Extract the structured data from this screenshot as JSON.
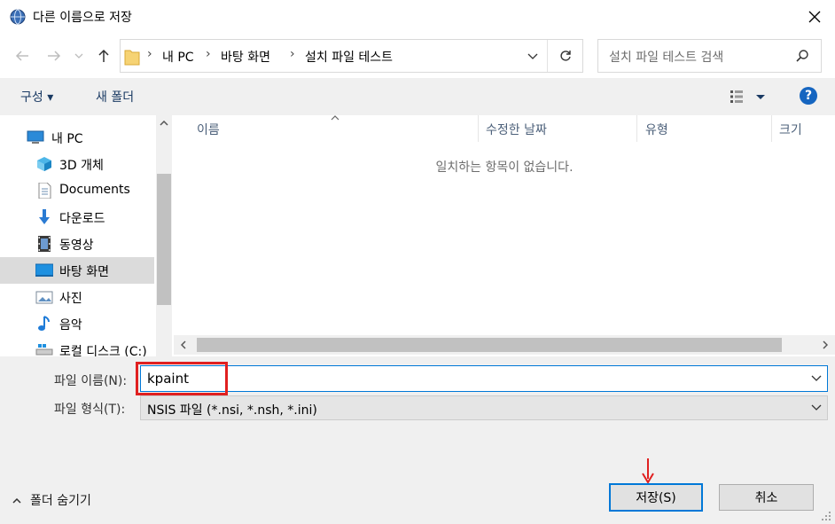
{
  "window": {
    "title": "다른 이름으로 저장",
    "close_label": "✕"
  },
  "address": {
    "crumbs": [
      "내 PC",
      "바탕 화면",
      "설치 파일 테스트"
    ]
  },
  "search": {
    "placeholder": "설치 파일 테스트 검색"
  },
  "toolbar": {
    "organize_label": "구성 ▾",
    "new_folder_label": "새 폴더",
    "help_label": "?"
  },
  "sidebar": {
    "items": [
      {
        "label": "내 PC",
        "icon": "pc-icon"
      },
      {
        "label": "3D 개체",
        "icon": "cube-3d-icon"
      },
      {
        "label": "Documents",
        "icon": "document-icon"
      },
      {
        "label": "다운로드",
        "icon": "download-icon"
      },
      {
        "label": "동영상",
        "icon": "video-icon"
      },
      {
        "label": "바탕 화면",
        "icon": "desktop-icon",
        "selected": true
      },
      {
        "label": "사진",
        "icon": "picture-icon"
      },
      {
        "label": "음악",
        "icon": "music-icon"
      },
      {
        "label": "로컬 디스크 (C:)",
        "icon": "drive-icon"
      }
    ]
  },
  "file_list": {
    "columns": [
      "이름",
      "수정한 날짜",
      "유형",
      "크기"
    ],
    "empty_message": "일치하는 항목이 없습니다."
  },
  "form": {
    "filename_label": "파일 이름(N):",
    "filename_value": "kpaint",
    "filetype_label": "파일 형식(T):",
    "filetype_value": "NSIS 파일 (*.nsi, *.nsh, *.ini)"
  },
  "footer": {
    "hide_folders_label": "폴더 숨기기",
    "save_label": "저장(S)",
    "cancel_label": "취소"
  },
  "colors": {
    "accent": "#0078d7",
    "highlight_box": "#e02020",
    "help_blue": "#1565c0"
  }
}
